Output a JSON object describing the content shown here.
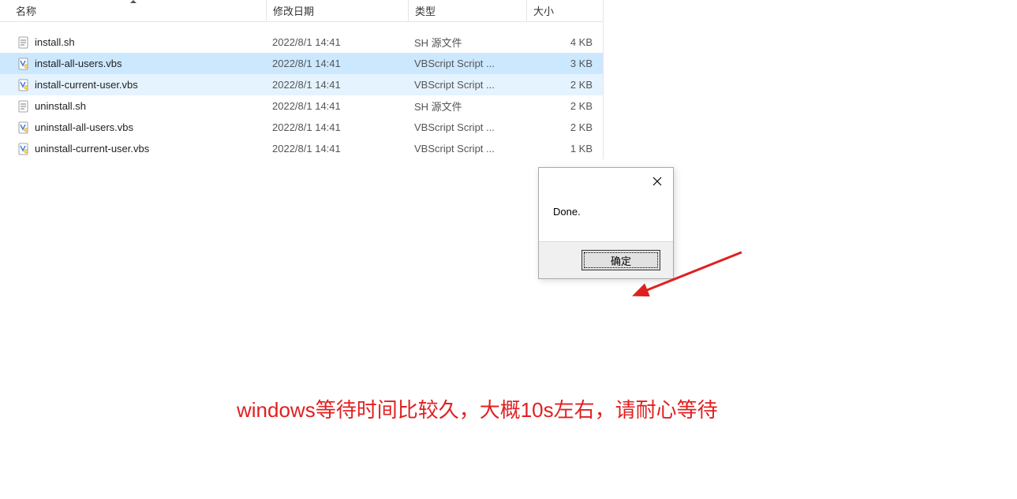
{
  "columns": {
    "name": "名称",
    "date": "修改日期",
    "type": "类型",
    "size": "大小"
  },
  "files": [
    {
      "name": "install.sh",
      "date": "2022/8/1 14:41",
      "type": "SH 源文件",
      "size": "4 KB",
      "icon": "sh",
      "state": ""
    },
    {
      "name": "install-all-users.vbs",
      "date": "2022/8/1 14:41",
      "type": "VBScript Script ...",
      "size": "3 KB",
      "icon": "vbs",
      "state": "selected"
    },
    {
      "name": "install-current-user.vbs",
      "date": "2022/8/1 14:41",
      "type": "VBScript Script ...",
      "size": "2 KB",
      "icon": "vbs",
      "state": "hover"
    },
    {
      "name": "uninstall.sh",
      "date": "2022/8/1 14:41",
      "type": "SH 源文件",
      "size": "2 KB",
      "icon": "sh",
      "state": ""
    },
    {
      "name": "uninstall-all-users.vbs",
      "date": "2022/8/1 14:41",
      "type": "VBScript Script ...",
      "size": "2 KB",
      "icon": "vbs",
      "state": ""
    },
    {
      "name": "uninstall-current-user.vbs",
      "date": "2022/8/1 14:41",
      "type": "VBScript Script ...",
      "size": "1 KB",
      "icon": "vbs",
      "state": ""
    }
  ],
  "dialog": {
    "message": "Done.",
    "ok_label": "确定"
  },
  "annotation": {
    "text": "windows等待时间比较久，大概10s左右，请耐心等待"
  }
}
